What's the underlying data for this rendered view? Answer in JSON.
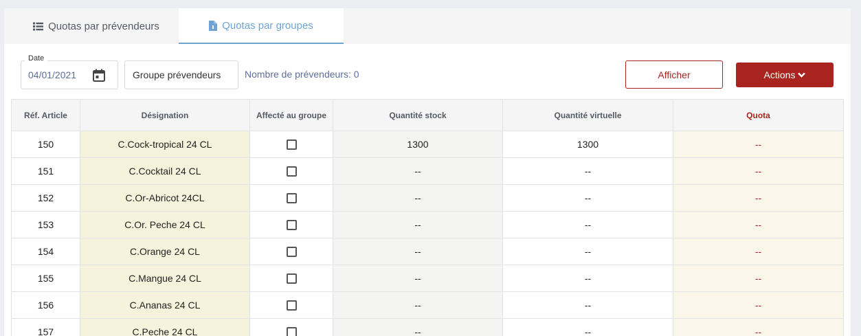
{
  "tabs": [
    {
      "label": "Quotas par prévendeurs",
      "icon": "list-icon",
      "active": false
    },
    {
      "label": "Quotas par groupes",
      "icon": "file-icon",
      "active": true
    }
  ],
  "filters": {
    "date_label": "Date",
    "date_value": "04/01/2021",
    "group_label": "Groupe prévendeurs",
    "count_text": "Nombre de prévendeurs: 0"
  },
  "buttons": {
    "afficher": "Afficher",
    "actions": "Actions"
  },
  "table": {
    "headers": [
      "Réf. Article",
      "Désignation",
      "Affecté au groupe",
      "Quantité stock",
      "Quantité virtuelle",
      "Quota"
    ],
    "rows": [
      {
        "ref": "150",
        "designation": "C.Cock-tropical 24 CL",
        "affecte": false,
        "stock": "1300",
        "virtuelle": "1300",
        "quota": "--"
      },
      {
        "ref": "151",
        "designation": "C.Cocktail 24 CL",
        "affecte": false,
        "stock": "--",
        "virtuelle": "--",
        "quota": "--"
      },
      {
        "ref": "152",
        "designation": "C.Or-Abricot 24CL",
        "affecte": false,
        "stock": "--",
        "virtuelle": "--",
        "quota": "--"
      },
      {
        "ref": "153",
        "designation": "C.Or. Peche 24 CL",
        "affecte": false,
        "stock": "--",
        "virtuelle": "--",
        "quota": "--"
      },
      {
        "ref": "154",
        "designation": "C.Orange 24 CL",
        "affecte": false,
        "stock": "--",
        "virtuelle": "--",
        "quota": "--"
      },
      {
        "ref": "155",
        "designation": "C.Mangue 24 CL",
        "affecte": false,
        "stock": "--",
        "virtuelle": "--",
        "quota": "--"
      },
      {
        "ref": "156",
        "designation": "C.Ananas 24 CL",
        "affecte": false,
        "stock": "--",
        "virtuelle": "--",
        "quota": "--"
      },
      {
        "ref": "157",
        "designation": "C.Peche 24 CL",
        "affecte": false,
        "stock": "--",
        "virtuelle": "--",
        "quota": "--"
      }
    ]
  },
  "colors": {
    "accent": "#a9241e",
    "tab_active": "#6fa3d3",
    "designation_bg": "#f6f3dc",
    "quota_bg": "#fbf6ea"
  }
}
